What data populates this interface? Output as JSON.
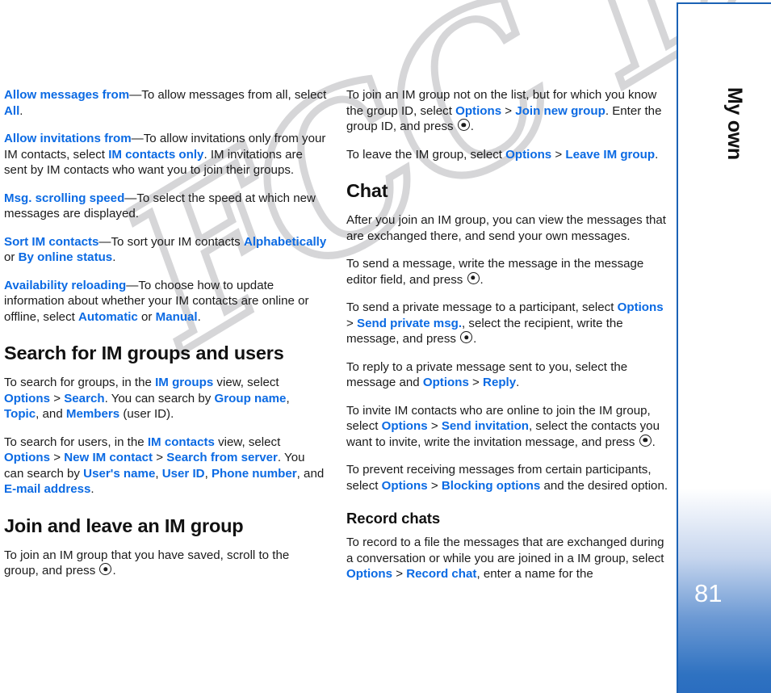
{
  "sidebar": {
    "chapter_title": "My own",
    "page_number": "81",
    "accent_color": "#1b62b5",
    "gradient_end_color": "#2a6dc0"
  },
  "watermark": {
    "text": "FCC Draft",
    "color": "#787880"
  },
  "colors": {
    "ui_term": "#0b6ae3",
    "body_text": "#1b1b1b",
    "heading": "#111111"
  },
  "icons": {
    "scroll_key": "scroll-key-icon"
  },
  "left_column": {
    "paragraphs": [
      {
        "id": "allow-messages-from",
        "parts": [
          {
            "type": "ui",
            "text": "Allow messages from"
          },
          {
            "type": "plain",
            "text": "—To allow messages from all, select "
          },
          {
            "type": "ui",
            "text": "All"
          },
          {
            "type": "plain",
            "text": "."
          }
        ]
      },
      {
        "id": "allow-invitations-from",
        "parts": [
          {
            "type": "ui",
            "text": "Allow invitations from"
          },
          {
            "type": "plain",
            "text": "—To allow invitations only from your IM contacts, select "
          },
          {
            "type": "ui",
            "text": "IM contacts only"
          },
          {
            "type": "plain",
            "text": ". IM invitations are sent by IM contacts who want you to join their groups."
          }
        ]
      },
      {
        "id": "msg-scrolling-speed",
        "parts": [
          {
            "type": "ui",
            "text": "Msg. scrolling speed"
          },
          {
            "type": "plain",
            "text": "—To select the speed at which new messages are displayed."
          }
        ]
      },
      {
        "id": "sort-im-contacts",
        "parts": [
          {
            "type": "ui",
            "text": "Sort IM contacts"
          },
          {
            "type": "plain",
            "text": "—To sort your IM contacts "
          },
          {
            "type": "ui",
            "text": "Alphabetically"
          },
          {
            "type": "plain",
            "text": " or "
          },
          {
            "type": "ui",
            "text": "By online status"
          },
          {
            "type": "plain",
            "text": "."
          }
        ]
      },
      {
        "id": "availability-reloading",
        "parts": [
          {
            "type": "ui",
            "text": "Availability reloading"
          },
          {
            "type": "plain",
            "text": "—To choose how to update information about whether your IM contacts are online or offline, select "
          },
          {
            "type": "ui",
            "text": "Automatic"
          },
          {
            "type": "plain",
            "text": " or "
          },
          {
            "type": "ui",
            "text": "Manual"
          },
          {
            "type": "plain",
            "text": "."
          }
        ]
      },
      {
        "id": "heading-search-im-groups",
        "type": "h2",
        "text": "Search for IM groups and users"
      },
      {
        "id": "search-for-groups",
        "parts": [
          {
            "type": "plain",
            "text": "To search for groups, in the "
          },
          {
            "type": "ui",
            "text": "IM groups"
          },
          {
            "type": "plain",
            "text": " view, select "
          },
          {
            "type": "ui",
            "text": "Options"
          },
          {
            "type": "sep",
            "text": " > "
          },
          {
            "type": "ui",
            "text": "Search"
          },
          {
            "type": "plain",
            "text": ". You can search by "
          },
          {
            "type": "ui",
            "text": "Group name"
          },
          {
            "type": "plain",
            "text": ", "
          },
          {
            "type": "ui",
            "text": "Topic"
          },
          {
            "type": "plain",
            "text": ", and "
          },
          {
            "type": "ui",
            "text": "Members"
          },
          {
            "type": "plain",
            "text": " (user ID)."
          }
        ]
      },
      {
        "id": "search-for-users",
        "parts": [
          {
            "type": "plain",
            "text": "To search for users, in the "
          },
          {
            "type": "ui",
            "text": "IM contacts"
          },
          {
            "type": "plain",
            "text": " view, select "
          },
          {
            "type": "ui",
            "text": "Options"
          },
          {
            "type": "sep",
            "text": " > "
          },
          {
            "type": "ui",
            "text": "New IM contact"
          },
          {
            "type": "sep",
            "text": " > "
          },
          {
            "type": "ui",
            "text": "Search from server"
          },
          {
            "type": "plain",
            "text": ". You can search by "
          },
          {
            "type": "ui",
            "text": "User's name"
          },
          {
            "type": "plain",
            "text": ", "
          },
          {
            "type": "ui",
            "text": "User ID"
          },
          {
            "type": "plain",
            "text": ", "
          },
          {
            "type": "ui",
            "text": "Phone number"
          },
          {
            "type": "plain",
            "text": ", and "
          },
          {
            "type": "ui",
            "text": "E-mail address"
          },
          {
            "type": "plain",
            "text": "."
          }
        ]
      },
      {
        "id": "heading-join-leave-im-group",
        "type": "h2",
        "text": "Join and leave an IM group"
      },
      {
        "id": "join-saved-group",
        "parts": [
          {
            "type": "plain",
            "text": "To join an IM group that you have saved, scroll to the group, and press "
          },
          {
            "type": "icon",
            "text": "scroll-key"
          },
          {
            "type": "plain",
            "text": "."
          }
        ]
      }
    ]
  },
  "right_column": {
    "paragraphs": [
      {
        "id": "join-new-group",
        "parts": [
          {
            "type": "plain",
            "text": "To join an IM group not on the list, but for which you know the group ID, select "
          },
          {
            "type": "ui",
            "text": "Options"
          },
          {
            "type": "sep",
            "text": " > "
          },
          {
            "type": "ui",
            "text": "Join new group"
          },
          {
            "type": "plain",
            "text": ". Enter the group ID, and press "
          },
          {
            "type": "icon",
            "text": "scroll-key"
          },
          {
            "type": "plain",
            "text": "."
          }
        ]
      },
      {
        "id": "leave-im-group",
        "parts": [
          {
            "type": "plain",
            "text": "To leave the IM group, select "
          },
          {
            "type": "ui",
            "text": "Options"
          },
          {
            "type": "sep",
            "text": " > "
          },
          {
            "type": "ui",
            "text": "Leave IM group"
          },
          {
            "type": "plain",
            "text": "."
          }
        ]
      },
      {
        "id": "heading-chat",
        "type": "h2",
        "text": "Chat"
      },
      {
        "id": "after-you-join",
        "parts": [
          {
            "type": "plain",
            "text": "After you join an IM group, you can view the messages that are exchanged there, and send your own messages."
          }
        ]
      },
      {
        "id": "send-a-message",
        "parts": [
          {
            "type": "plain",
            "text": "To send a message, write the message in the message editor field, and press "
          },
          {
            "type": "icon",
            "text": "scroll-key"
          },
          {
            "type": "plain",
            "text": "."
          }
        ]
      },
      {
        "id": "send-private-message",
        "parts": [
          {
            "type": "plain",
            "text": "To send a private message to a participant, select "
          },
          {
            "type": "ui",
            "text": "Options"
          },
          {
            "type": "sep",
            "text": " > "
          },
          {
            "type": "ui",
            "text": "Send private msg."
          },
          {
            "type": "plain",
            "text": ", select the recipient, write the message, and press "
          },
          {
            "type": "icon",
            "text": "scroll-key"
          },
          {
            "type": "plain",
            "text": "."
          }
        ]
      },
      {
        "id": "reply-private-message",
        "parts": [
          {
            "type": "plain",
            "text": "To reply to a private message sent to you, select the message and "
          },
          {
            "type": "ui",
            "text": "Options"
          },
          {
            "type": "sep",
            "text": " > "
          },
          {
            "type": "ui",
            "text": "Reply"
          },
          {
            "type": "plain",
            "text": "."
          }
        ]
      },
      {
        "id": "send-invitation",
        "parts": [
          {
            "type": "plain",
            "text": "To invite IM contacts who are online to join the IM group, select "
          },
          {
            "type": "ui",
            "text": "Options"
          },
          {
            "type": "sep",
            "text": " > "
          },
          {
            "type": "ui",
            "text": "Send invitation"
          },
          {
            "type": "plain",
            "text": ", select the contacts you want to invite, write the invitation message, and press "
          },
          {
            "type": "icon",
            "text": "scroll-key"
          },
          {
            "type": "plain",
            "text": "."
          }
        ]
      },
      {
        "id": "blocking-options",
        "parts": [
          {
            "type": "plain",
            "text": "To prevent receiving messages from certain participants, select "
          },
          {
            "type": "ui",
            "text": "Options"
          },
          {
            "type": "sep",
            "text": " > "
          },
          {
            "type": "ui",
            "text": "Blocking options"
          },
          {
            "type": "plain",
            "text": " and the desired option."
          }
        ]
      },
      {
        "id": "heading-record-chats",
        "type": "h3",
        "text": "Record chats"
      },
      {
        "id": "record-chat",
        "parts": [
          {
            "type": "plain",
            "text": "To record to a file the messages that are exchanged during a conversation or while you are joined in a IM group, select "
          },
          {
            "type": "ui",
            "text": "Options"
          },
          {
            "type": "sep",
            "text": " > "
          },
          {
            "type": "ui",
            "text": "Record chat"
          },
          {
            "type": "plain",
            "text": ", enter a name for the"
          }
        ]
      }
    ]
  }
}
